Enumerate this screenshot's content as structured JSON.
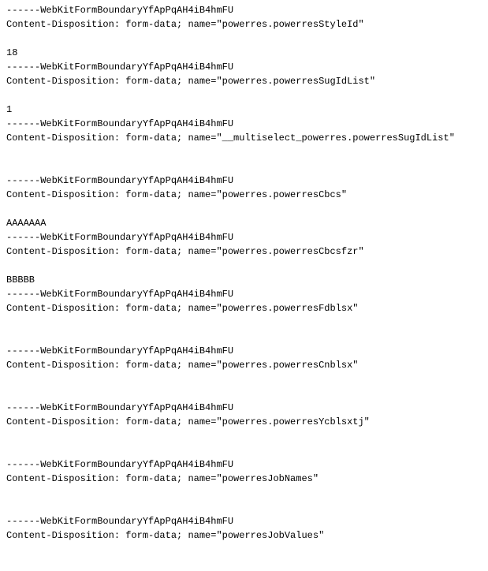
{
  "parts": [
    {
      "boundary": "------WebKitFormBoundaryYfApPqAH4iB4hmFU",
      "header": "Content-Disposition: form-data; name=\"powerres.powerresStyleId\"",
      "value": "18"
    },
    {
      "boundary": "------WebKitFormBoundaryYfApPqAH4iB4hmFU",
      "header": "Content-Disposition: form-data; name=\"powerres.powerresSugIdList\"",
      "value": "1"
    },
    {
      "boundary": "------WebKitFormBoundaryYfApPqAH4iB4hmFU",
      "header": "Content-Disposition: form-data; name=\"__multiselect_powerres.powerresSugIdList\"",
      "value": ""
    },
    {
      "boundary": "------WebKitFormBoundaryYfApPqAH4iB4hmFU",
      "header": "Content-Disposition: form-data; name=\"powerres.powerresCbcs\"",
      "value": "AAAAAAA"
    },
    {
      "boundary": "------WebKitFormBoundaryYfApPqAH4iB4hmFU",
      "header": "Content-Disposition: form-data; name=\"powerres.powerresCbcsfzr\"",
      "value": "BBBBB"
    },
    {
      "boundary": "------WebKitFormBoundaryYfApPqAH4iB4hmFU",
      "header": "Content-Disposition: form-data; name=\"powerres.powerresFdblsx\"",
      "value": ""
    },
    {
      "boundary": "------WebKitFormBoundaryYfApPqAH4iB4hmFU",
      "header": "Content-Disposition: form-data; name=\"powerres.powerresCnblsx\"",
      "value": ""
    },
    {
      "boundary": "------WebKitFormBoundaryYfApPqAH4iB4hmFU",
      "header": "Content-Disposition: form-data; name=\"powerres.powerresYcblsxtj\"",
      "value": ""
    },
    {
      "boundary": "------WebKitFormBoundaryYfApPqAH4iB4hmFU",
      "header": "Content-Disposition: form-data; name=\"powerresJobNames\"",
      "value": ""
    },
    {
      "boundary": "------WebKitFormBoundaryYfApPqAH4iB4hmFU",
      "header": "Content-Disposition: form-data; name=\"powerresJobValues\"",
      "value": ""
    }
  ]
}
